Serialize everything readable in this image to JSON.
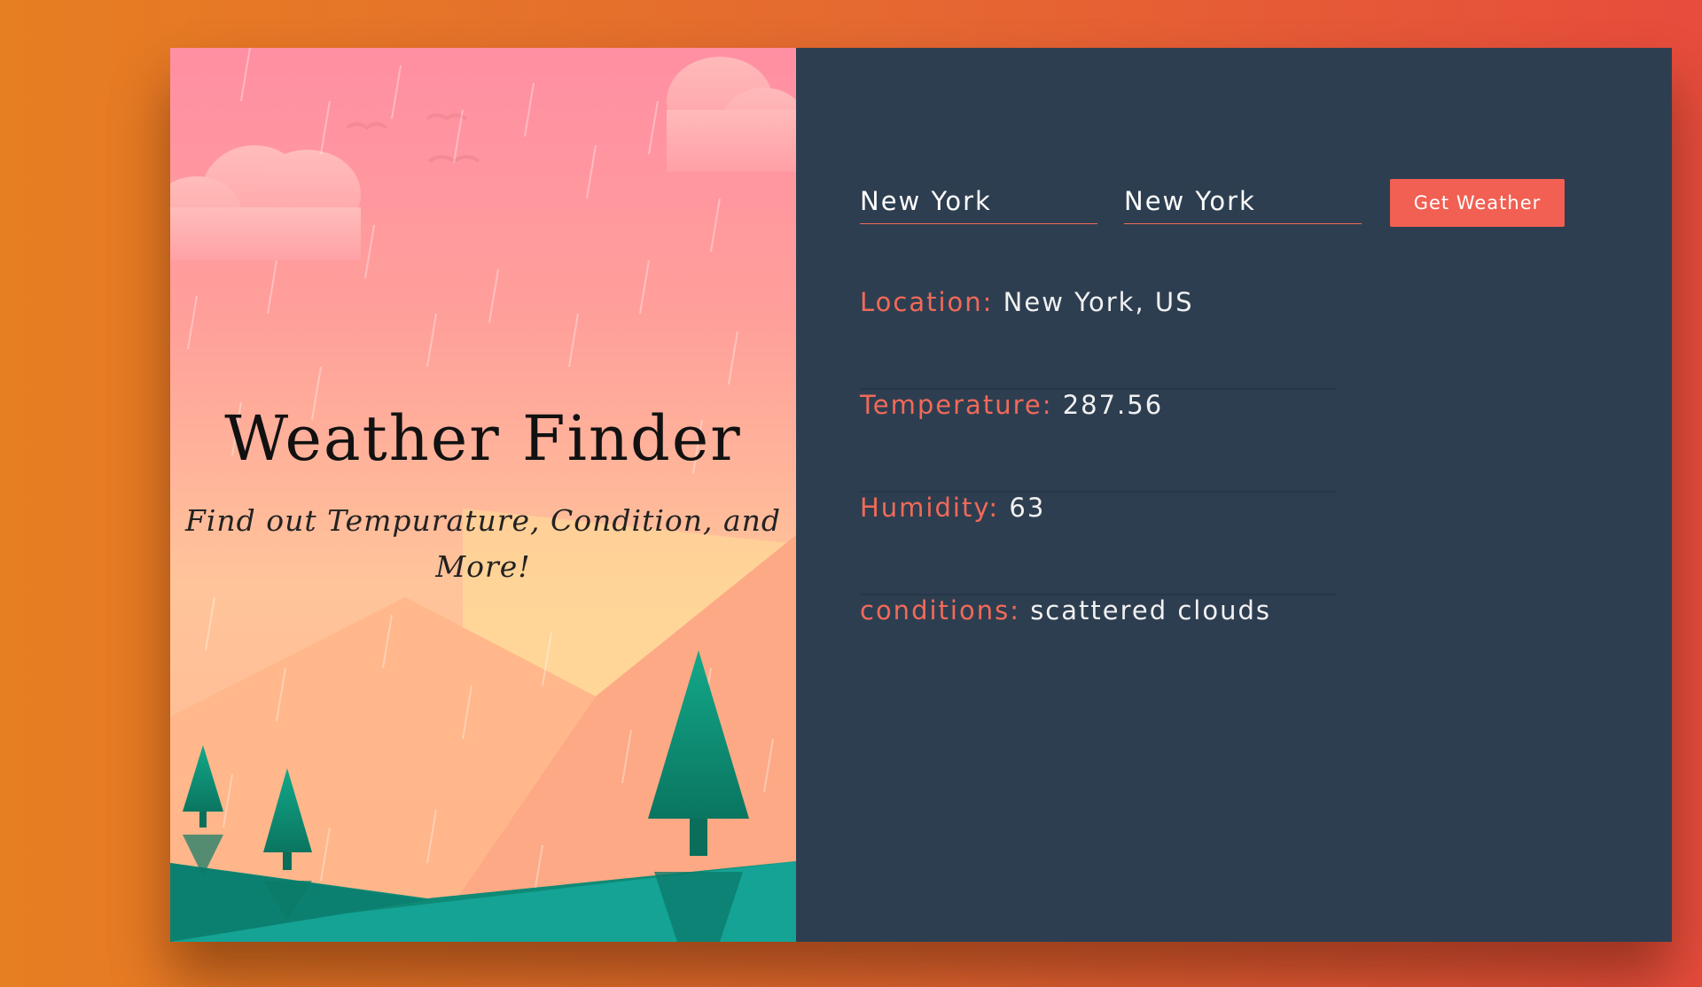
{
  "app": {
    "title": "Weather Finder",
    "subtitle": "Find out Tempurature, Condition, and More!"
  },
  "form": {
    "city_value": "New York",
    "country_value": "New York",
    "submit_label": "Get Weather"
  },
  "results": {
    "location_label": "Location:",
    "location_value": "New York, US",
    "temperature_label": "Temperature:",
    "temperature_value": "287.56",
    "humidity_label": "Humidity:",
    "humidity_value": "63",
    "conditions_label": "conditions:",
    "conditions_value": "scattered clouds"
  },
  "colors": {
    "accent": "#f16052",
    "panel": "#2e3e51",
    "background_start": "#e67e22",
    "background_end": "#e74c3c"
  }
}
